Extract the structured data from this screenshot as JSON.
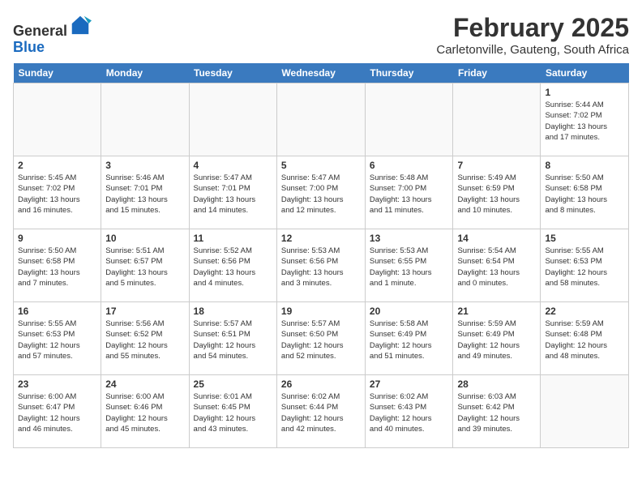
{
  "header": {
    "logo_line1": "General",
    "logo_line2": "Blue",
    "month": "February 2025",
    "location": "Carletonville, Gauteng, South Africa"
  },
  "weekdays": [
    "Sunday",
    "Monday",
    "Tuesday",
    "Wednesday",
    "Thursday",
    "Friday",
    "Saturday"
  ],
  "weeks": [
    [
      {
        "day": "",
        "info": ""
      },
      {
        "day": "",
        "info": ""
      },
      {
        "day": "",
        "info": ""
      },
      {
        "day": "",
        "info": ""
      },
      {
        "day": "",
        "info": ""
      },
      {
        "day": "",
        "info": ""
      },
      {
        "day": "1",
        "info": "Sunrise: 5:44 AM\nSunset: 7:02 PM\nDaylight: 13 hours\nand 17 minutes."
      }
    ],
    [
      {
        "day": "2",
        "info": "Sunrise: 5:45 AM\nSunset: 7:02 PM\nDaylight: 13 hours\nand 16 minutes."
      },
      {
        "day": "3",
        "info": "Sunrise: 5:46 AM\nSunset: 7:01 PM\nDaylight: 13 hours\nand 15 minutes."
      },
      {
        "day": "4",
        "info": "Sunrise: 5:47 AM\nSunset: 7:01 PM\nDaylight: 13 hours\nand 14 minutes."
      },
      {
        "day": "5",
        "info": "Sunrise: 5:47 AM\nSunset: 7:00 PM\nDaylight: 13 hours\nand 12 minutes."
      },
      {
        "day": "6",
        "info": "Sunrise: 5:48 AM\nSunset: 7:00 PM\nDaylight: 13 hours\nand 11 minutes."
      },
      {
        "day": "7",
        "info": "Sunrise: 5:49 AM\nSunset: 6:59 PM\nDaylight: 13 hours\nand 10 minutes."
      },
      {
        "day": "8",
        "info": "Sunrise: 5:50 AM\nSunset: 6:58 PM\nDaylight: 13 hours\nand 8 minutes."
      }
    ],
    [
      {
        "day": "9",
        "info": "Sunrise: 5:50 AM\nSunset: 6:58 PM\nDaylight: 13 hours\nand 7 minutes."
      },
      {
        "day": "10",
        "info": "Sunrise: 5:51 AM\nSunset: 6:57 PM\nDaylight: 13 hours\nand 5 minutes."
      },
      {
        "day": "11",
        "info": "Sunrise: 5:52 AM\nSunset: 6:56 PM\nDaylight: 13 hours\nand 4 minutes."
      },
      {
        "day": "12",
        "info": "Sunrise: 5:53 AM\nSunset: 6:56 PM\nDaylight: 13 hours\nand 3 minutes."
      },
      {
        "day": "13",
        "info": "Sunrise: 5:53 AM\nSunset: 6:55 PM\nDaylight: 13 hours\nand 1 minute."
      },
      {
        "day": "14",
        "info": "Sunrise: 5:54 AM\nSunset: 6:54 PM\nDaylight: 13 hours\nand 0 minutes."
      },
      {
        "day": "15",
        "info": "Sunrise: 5:55 AM\nSunset: 6:53 PM\nDaylight: 12 hours\nand 58 minutes."
      }
    ],
    [
      {
        "day": "16",
        "info": "Sunrise: 5:55 AM\nSunset: 6:53 PM\nDaylight: 12 hours\nand 57 minutes."
      },
      {
        "day": "17",
        "info": "Sunrise: 5:56 AM\nSunset: 6:52 PM\nDaylight: 12 hours\nand 55 minutes."
      },
      {
        "day": "18",
        "info": "Sunrise: 5:57 AM\nSunset: 6:51 PM\nDaylight: 12 hours\nand 54 minutes."
      },
      {
        "day": "19",
        "info": "Sunrise: 5:57 AM\nSunset: 6:50 PM\nDaylight: 12 hours\nand 52 minutes."
      },
      {
        "day": "20",
        "info": "Sunrise: 5:58 AM\nSunset: 6:49 PM\nDaylight: 12 hours\nand 51 minutes."
      },
      {
        "day": "21",
        "info": "Sunrise: 5:59 AM\nSunset: 6:49 PM\nDaylight: 12 hours\nand 49 minutes."
      },
      {
        "day": "22",
        "info": "Sunrise: 5:59 AM\nSunset: 6:48 PM\nDaylight: 12 hours\nand 48 minutes."
      }
    ],
    [
      {
        "day": "23",
        "info": "Sunrise: 6:00 AM\nSunset: 6:47 PM\nDaylight: 12 hours\nand 46 minutes."
      },
      {
        "day": "24",
        "info": "Sunrise: 6:00 AM\nSunset: 6:46 PM\nDaylight: 12 hours\nand 45 minutes."
      },
      {
        "day": "25",
        "info": "Sunrise: 6:01 AM\nSunset: 6:45 PM\nDaylight: 12 hours\nand 43 minutes."
      },
      {
        "day": "26",
        "info": "Sunrise: 6:02 AM\nSunset: 6:44 PM\nDaylight: 12 hours\nand 42 minutes."
      },
      {
        "day": "27",
        "info": "Sunrise: 6:02 AM\nSunset: 6:43 PM\nDaylight: 12 hours\nand 40 minutes."
      },
      {
        "day": "28",
        "info": "Sunrise: 6:03 AM\nSunset: 6:42 PM\nDaylight: 12 hours\nand 39 minutes."
      },
      {
        "day": "",
        "info": ""
      }
    ]
  ]
}
